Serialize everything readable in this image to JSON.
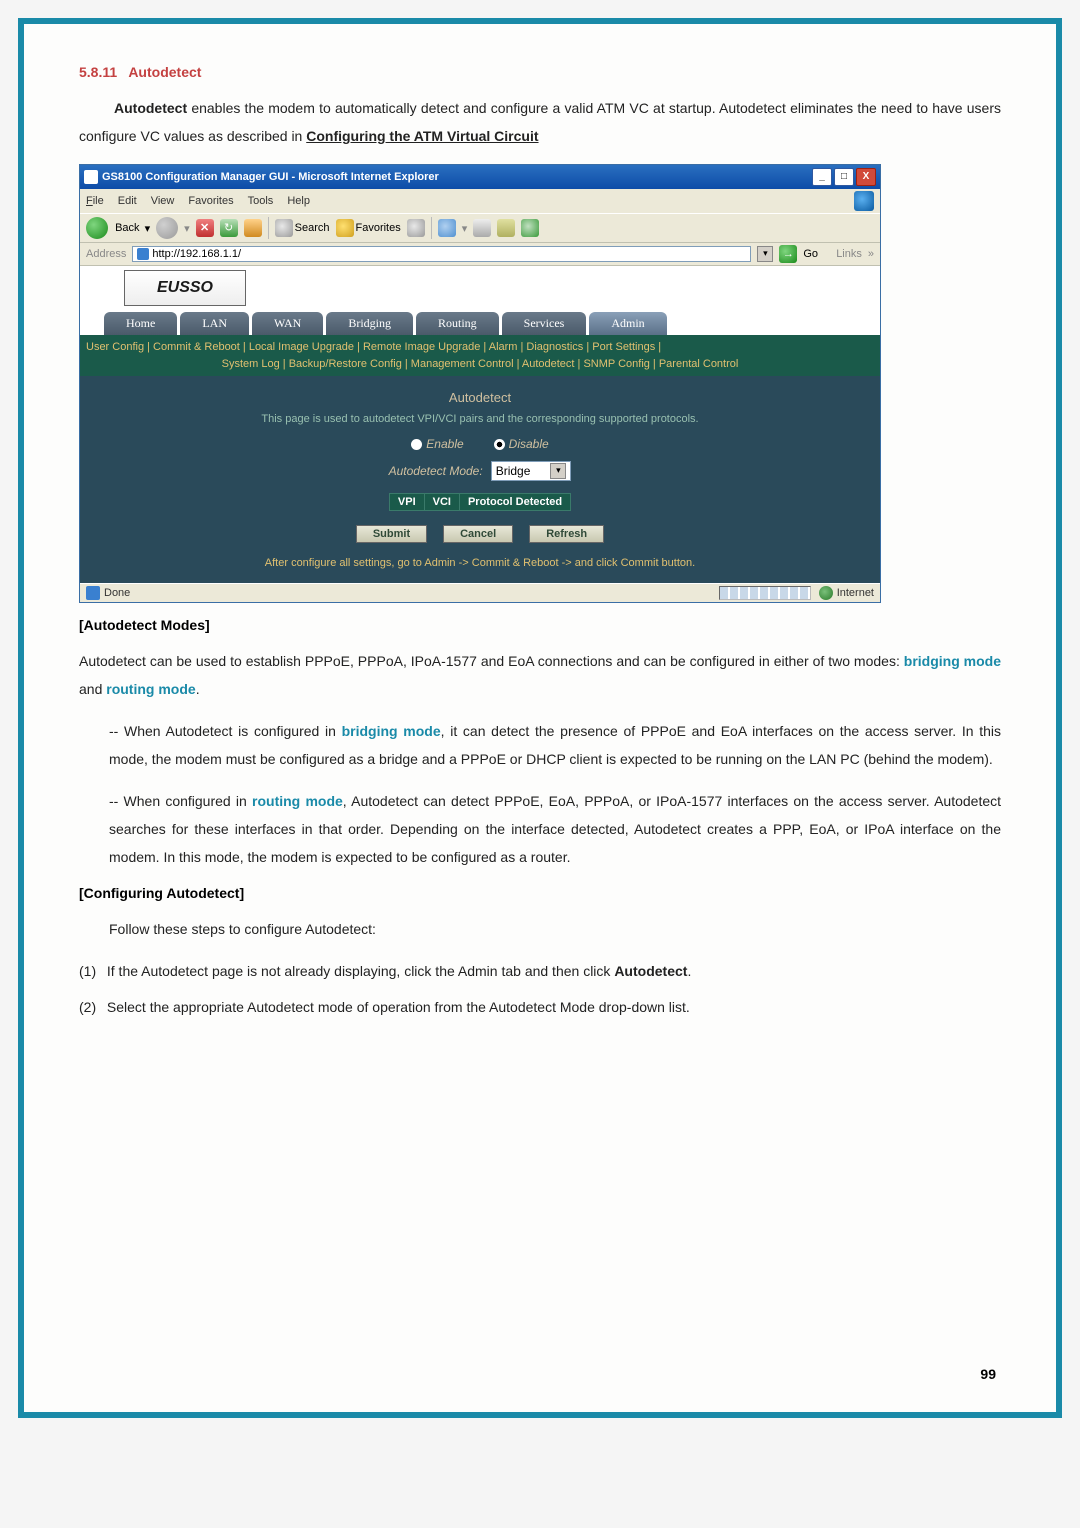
{
  "section": {
    "number": "5.8.11",
    "title": "Autodetect"
  },
  "intro": {
    "sentence1_prefix": "Autodetect",
    "sentence1_rest": " enables the modem to automatically detect and configure a valid ATM VC at startup. Autodetect eliminates the need to have users configure VC values as described in ",
    "link": "Configuring the ATM Virtual Circuit"
  },
  "browser": {
    "title": "GS8100 Configuration Manager GUI - Microsoft Internet Explorer",
    "menus": [
      "File",
      "Edit",
      "View",
      "Favorites",
      "Tools",
      "Help"
    ],
    "toolbar": {
      "back": "Back",
      "search": "Search",
      "favorites": "Favorites"
    },
    "address_label": "Address",
    "address_url": "http://192.168.1.1/",
    "go": "Go",
    "links": "Links",
    "logo": "EUSSO",
    "tabs": [
      "Home",
      "LAN",
      "WAN",
      "Bridging",
      "Routing",
      "Services",
      "Admin"
    ],
    "subnav_line1": "User Config | Commit & Reboot | Local Image Upgrade | Remote Image Upgrade | Alarm | Diagnostics | Port Settings |",
    "subnav_line2": "System Log | Backup/Restore Config | Management Control | Autodetect | SNMP Config | Parental Control",
    "panel_title": "Autodetect",
    "panel_note": "This page is used to autodetect VPI/VCI pairs and the corresponding supported protocols.",
    "radio_enable": "Enable",
    "radio_disable": "Disable",
    "mode_label": "Autodetect Mode:",
    "mode_value": "Bridge",
    "table_headers": [
      "VPI",
      "VCI",
      "Protocol Detected"
    ],
    "buttons": {
      "submit": "Submit",
      "cancel": "Cancel",
      "refresh": "Refresh"
    },
    "commit_note": "After configure all settings, go to Admin -> Commit & Reboot -> and click Commit button.",
    "status_done": "Done",
    "status_zone": "Internet"
  },
  "modes": {
    "heading": "[Autodetect Modes]",
    "para1_a": "Autodetect can be used to establish PPPoE, PPPoA, IPoA-1577 and EoA connections and can be configured in either of two modes: ",
    "bridging": "bridging mode",
    "and": " and ",
    "routing": "routing mode",
    "dot": ".",
    "bridge_prefix": "-- When Autodetect is configured in ",
    "bridge_rest": ", it can detect the presence of PPPoE and EoA interfaces on the access server. In this mode, the modem must be configured as a bridge and a PPPoE or DHCP client is expected to be running on the LAN PC (behind the modem).",
    "route_prefix": "-- When configured in ",
    "route_rest": ", Autodetect can detect  PPPoE, EoA, PPPoA, or IPoA-1577 interfaces on the access server. Autodetect searches for these interfaces in that order. Depending on the interface detected, Autodetect creates a PPP, EoA, or IPoA interface on the modem. In this mode, the modem is expected to be configured as a router."
  },
  "config": {
    "heading": "[Configuring Autodetect]",
    "intro": "Follow these steps to configure Autodetect:",
    "steps": [
      {
        "num": "(1)",
        "text_a": "If the Autodetect page is not already displaying, click the Admin tab and then click ",
        "bold": "Autodetect",
        "text_b": "."
      },
      {
        "num": "(2)",
        "text_a": "Select the appropriate Autodetect mode of operation from the Autodetect Mode drop-down list.",
        "bold": "",
        "text_b": ""
      }
    ]
  },
  "page_number": "99"
}
